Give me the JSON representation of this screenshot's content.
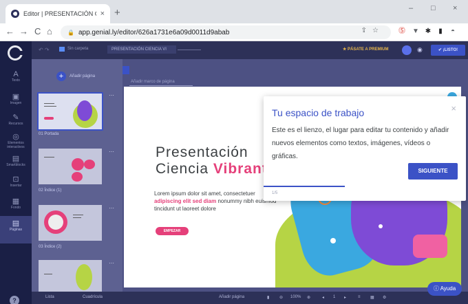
{
  "browser": {
    "tab_title": "Editor | PRESENTACIÓN CIENCIA",
    "tab_close": "×",
    "new_tab": "+",
    "url": "app.genial.ly/editor/626a1731e6a09d0011d9abab",
    "nav": {
      "back": "←",
      "forward": "→",
      "reload": "C",
      "home": "⌂"
    },
    "window_controls": {
      "minimize": "–",
      "maximize": "□",
      "close": "×"
    }
  },
  "rail": {
    "items": [
      {
        "icon": "A",
        "label": "Texto"
      },
      {
        "icon": "▣",
        "label": "Imagen"
      },
      {
        "icon": "✎",
        "label": "Recursos"
      },
      {
        "icon": "◎",
        "label": "Elementos interactivos"
      },
      {
        "icon": "▤",
        "label": "Smartblocks"
      },
      {
        "icon": "⊡",
        "label": "Insertar"
      },
      {
        "icon": "▦",
        "label": "Fondo"
      },
      {
        "icon": "▤",
        "label": "Páginas"
      }
    ],
    "help": "?"
  },
  "topbar": {
    "folder": "Sin carpeta",
    "name": "PRESENTACIÓN CIENCIA VI",
    "premium": "★ PÁSATE A PREMIUM",
    "ready": "✔ ¡LISTO!"
  },
  "panel": {
    "add_page": "Añadir página",
    "pages": [
      {
        "label": "01 Portada"
      },
      {
        "label": "02 Índice (1)"
      },
      {
        "label": "03 Índice (2)"
      }
    ],
    "bottom": {
      "pages": "Lista",
      "layout": "Cuadrícula"
    }
  },
  "canvas": {
    "hint": "Añadir marco de página",
    "slide": {
      "title_line1": "Presentación",
      "title_line2_prefix": "Ciencia ",
      "title_line2_accent": "Vibrant",
      "body_start": "Lorem ipsum dolor sit amet, consectetuer",
      "body_bold": "adipiscing elit sed diam",
      "body_end": "nonummy nibh euismod tincidunt ut laoreet dolore",
      "button": "EMPEZAR"
    }
  },
  "tooltip": {
    "title": "Tu espacio de trabajo",
    "body": "Este es el lienzo, el lugar para editar tu contenido y añadir nuevos elementos como textos, imágenes, vídeos o gráficas.",
    "button": "SIGUIENTE",
    "counter": "1/5",
    "progress": 0.2,
    "close": "×"
  },
  "bottombar": {
    "add_page": "Añadir página",
    "zoom": "100%",
    "page": "1"
  },
  "help_button": "Ayuda",
  "colors": {
    "accent_blue": "#3b52c6",
    "accent_pink": "#e5407a",
    "rail_bg": "#1a1f45"
  }
}
